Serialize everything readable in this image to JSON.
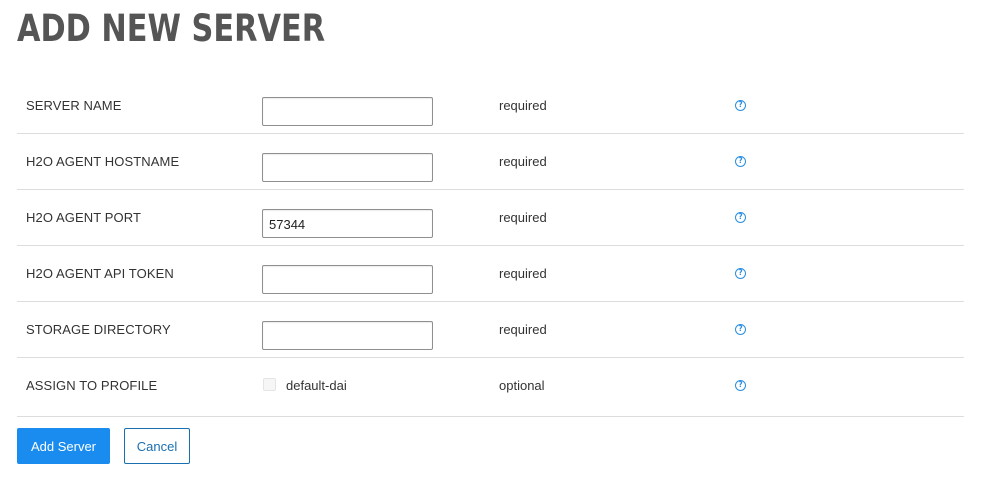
{
  "page": {
    "title": "ADD NEW SERVER"
  },
  "rows": [
    {
      "label": "SERVER NAME",
      "value": "",
      "status": "required",
      "help_icon": "question-circle"
    },
    {
      "label": "H2O AGENT HOSTNAME",
      "value": "",
      "status": "required",
      "help_icon": "question-circle"
    },
    {
      "label": "H2O AGENT PORT",
      "value": "57344",
      "status": "required",
      "help_icon": "question-circle"
    },
    {
      "label": "H2O AGENT API TOKEN",
      "value": "",
      "status": "required",
      "help_icon": "question-circle"
    },
    {
      "label": "STORAGE DIRECTORY",
      "value": "",
      "status": "required",
      "help_icon": "question-circle"
    },
    {
      "label": "ASSIGN TO PROFILE",
      "checkbox_label": "default-dai",
      "checked": false,
      "status": "optional",
      "help_icon": "question-circle"
    }
  ],
  "buttons": {
    "add_label": "Add Server",
    "cancel_label": "Cancel"
  },
  "colors": {
    "primary": "#1a8cf0",
    "link": "#1a6fb0",
    "help_icon": "#2b8fe0",
    "title": "#555555"
  }
}
